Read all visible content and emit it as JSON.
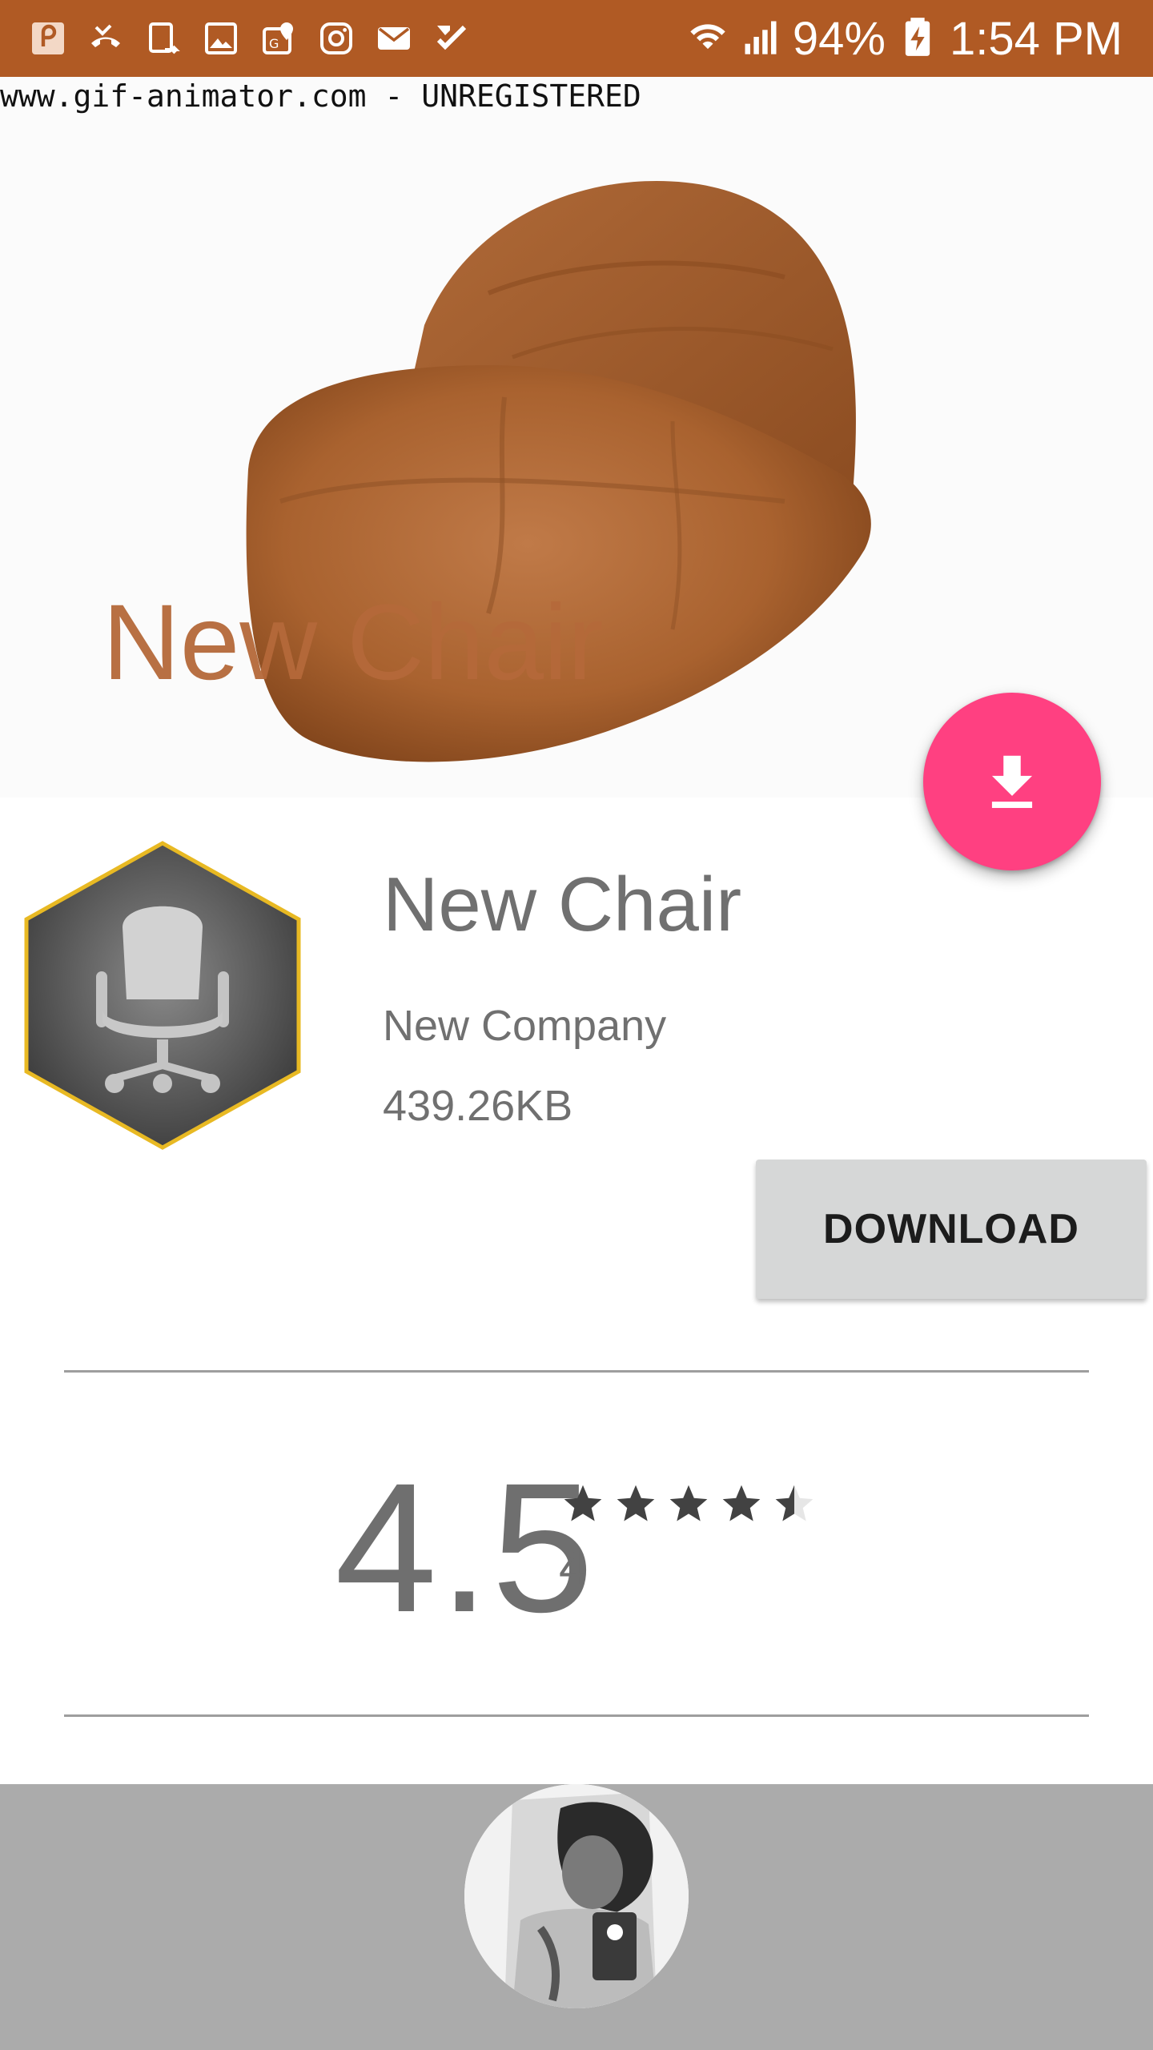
{
  "status_bar": {
    "battery": "94%",
    "time": "1:54 PM",
    "left_icons": [
      "app-p-icon",
      "missed-call-icon",
      "screen-rotate-icon",
      "gallery-icon",
      "maps-icon",
      "instagram-icon",
      "mail-icon",
      "task-check-icon"
    ],
    "right_icons": [
      "wifi-icon",
      "signal-icon",
      "battery-charging-icon"
    ],
    "background_color": "#b05a24"
  },
  "watermark": {
    "text": "www.gif-animator.com - UNREGISTERED"
  },
  "hero": {
    "title": "New Chair",
    "title_color": "#b5693a",
    "image": "bean-bag-chair"
  },
  "fab": {
    "icon": "download-icon",
    "color": "#ff4081"
  },
  "app": {
    "name": "New Chair",
    "company": "New Company",
    "size": "439.26KB",
    "icon": "office-chair-hexagon-icon",
    "download_label": "DOWNLOAD"
  },
  "rating": {
    "value": "4.5",
    "count": "4",
    "stars": 4.5
  },
  "profile": {
    "avatar": "user-avatar-photo"
  }
}
